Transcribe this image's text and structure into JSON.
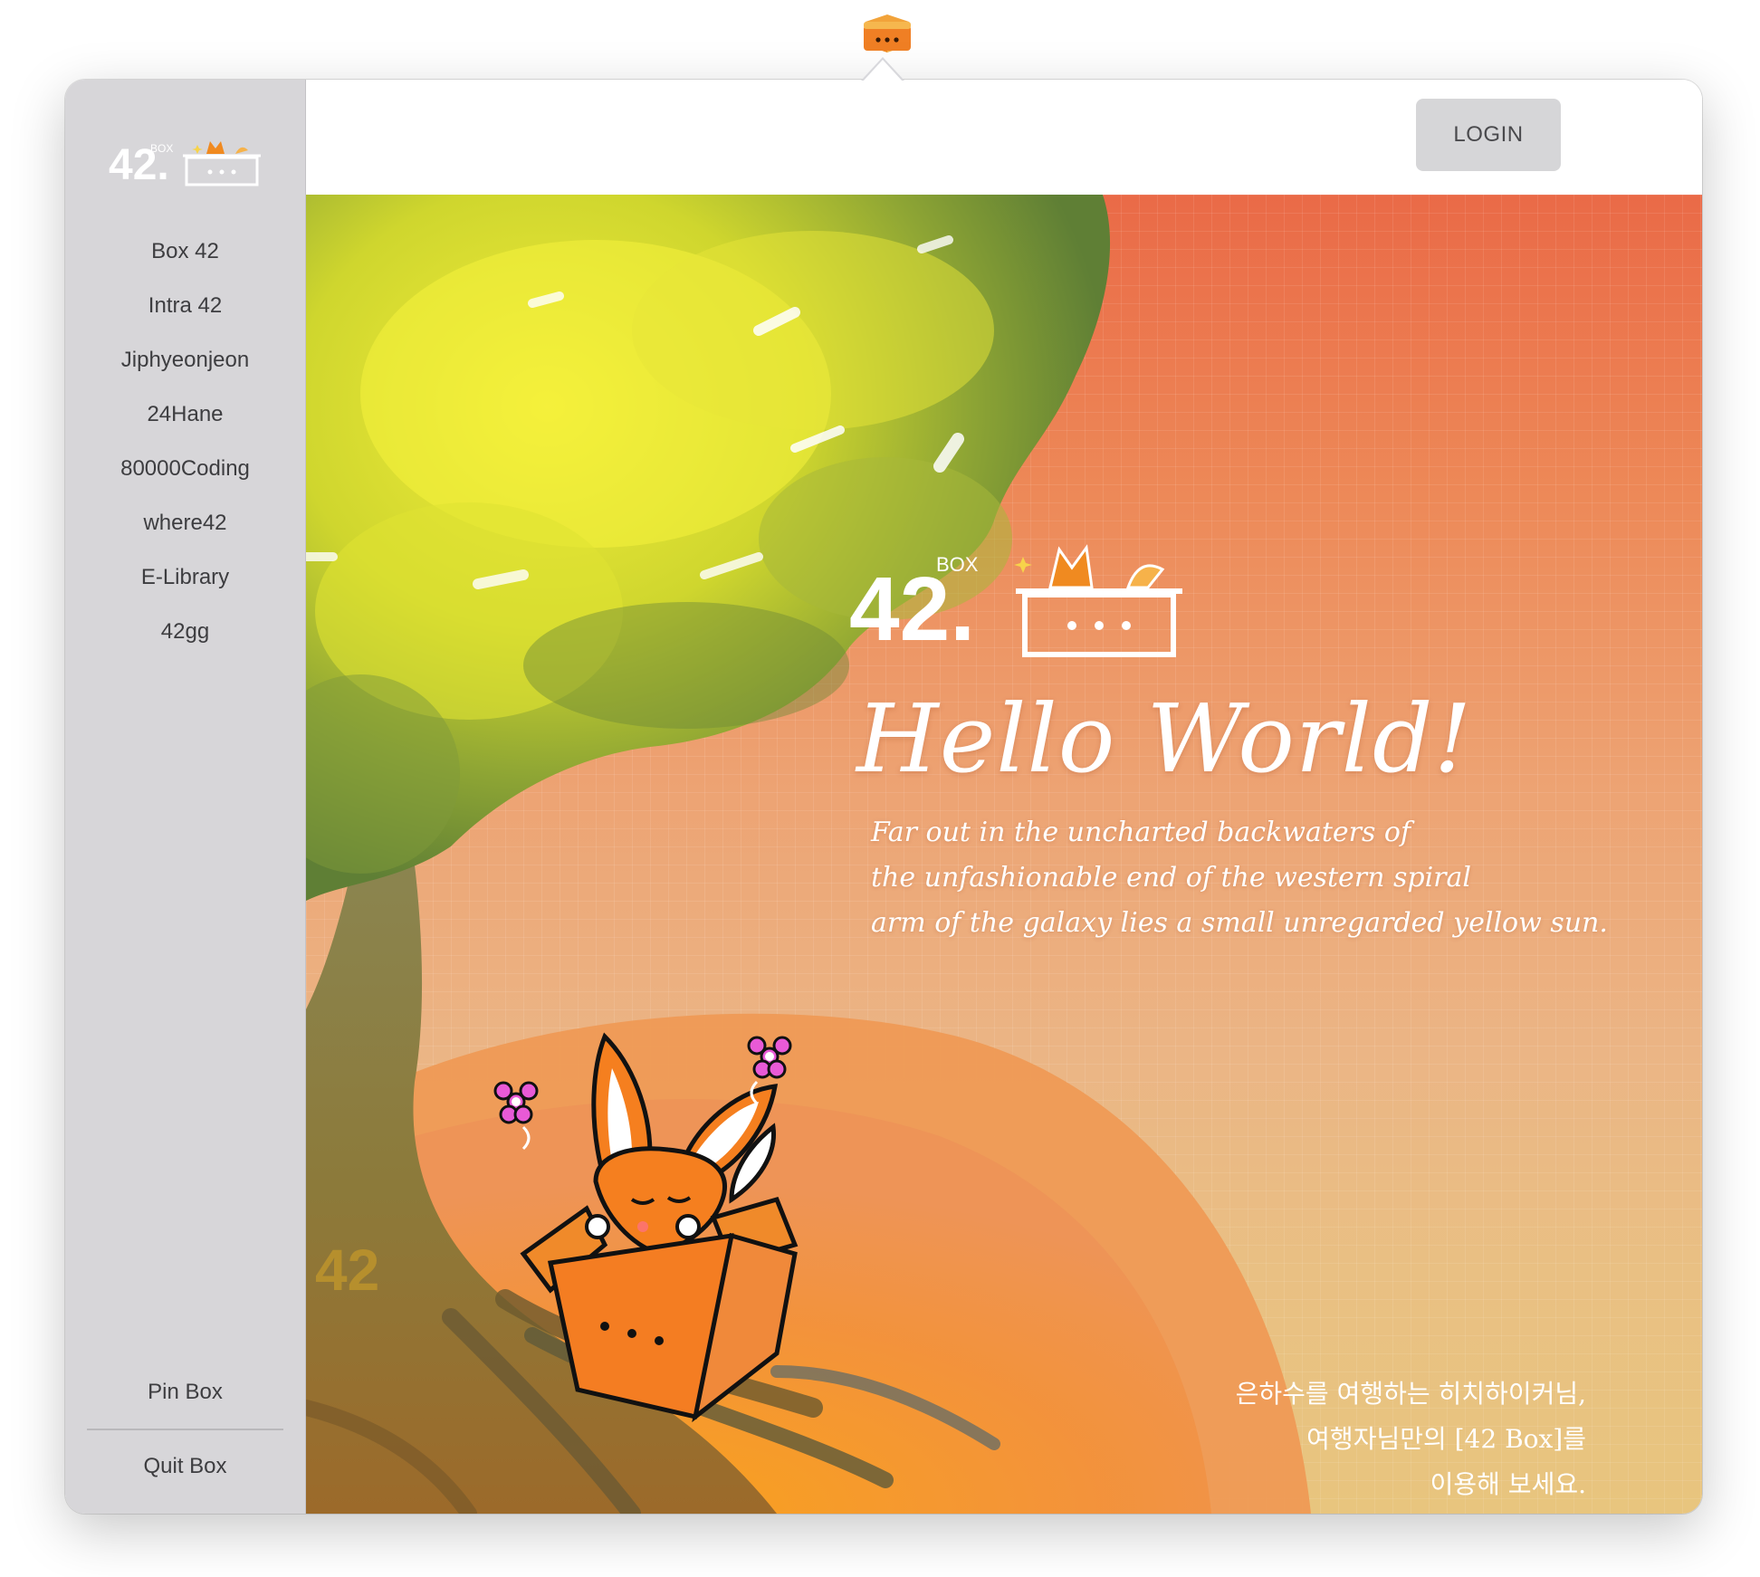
{
  "sidebar": {
    "items": [
      {
        "label": "Box 42",
        "id": "box-42"
      },
      {
        "label": "Intra 42",
        "id": "intra-42"
      },
      {
        "label": "Jiphyeonjeon",
        "id": "jiphyeonjeon"
      },
      {
        "label": "24Hane",
        "id": "24hane"
      },
      {
        "label": "80000Coding",
        "id": "80000coding"
      },
      {
        "label": "where42",
        "id": "where42"
      },
      {
        "label": "E-Library",
        "id": "e-library"
      },
      {
        "label": "42gg",
        "id": "42gg"
      }
    ],
    "pin_label": "Pin Box",
    "quit_label": "Quit Box"
  },
  "logo": {
    "number": "42.",
    "box_word": "BOX"
  },
  "header": {
    "login_label": "LOGIN"
  },
  "hero": {
    "title": "Hello World!",
    "subtitle_lines": [
      "Far out in the uncharted backwaters of",
      "the unfashionable end of the western spiral",
      "arm of the galaxy lies a small unregarded yellow sun."
    ],
    "korean_lines": [
      "은하수를 여행하는 히치하이커님,",
      "여행자님만의 [42 Box]를",
      "이용해 보세요."
    ],
    "watermark": "42"
  },
  "colors": {
    "sidebar_bg": "#d7d6d9",
    "hero_top": "#ea6a47",
    "hero_bottom": "#e8c57e",
    "box_orange": "#f07f24",
    "login_bg": "#d6d6d8"
  },
  "icons": {
    "tray": "box-tray-icon",
    "logo": "42-box-logo",
    "fox": "fox-in-box-illustration",
    "flower": "flower-icon"
  }
}
